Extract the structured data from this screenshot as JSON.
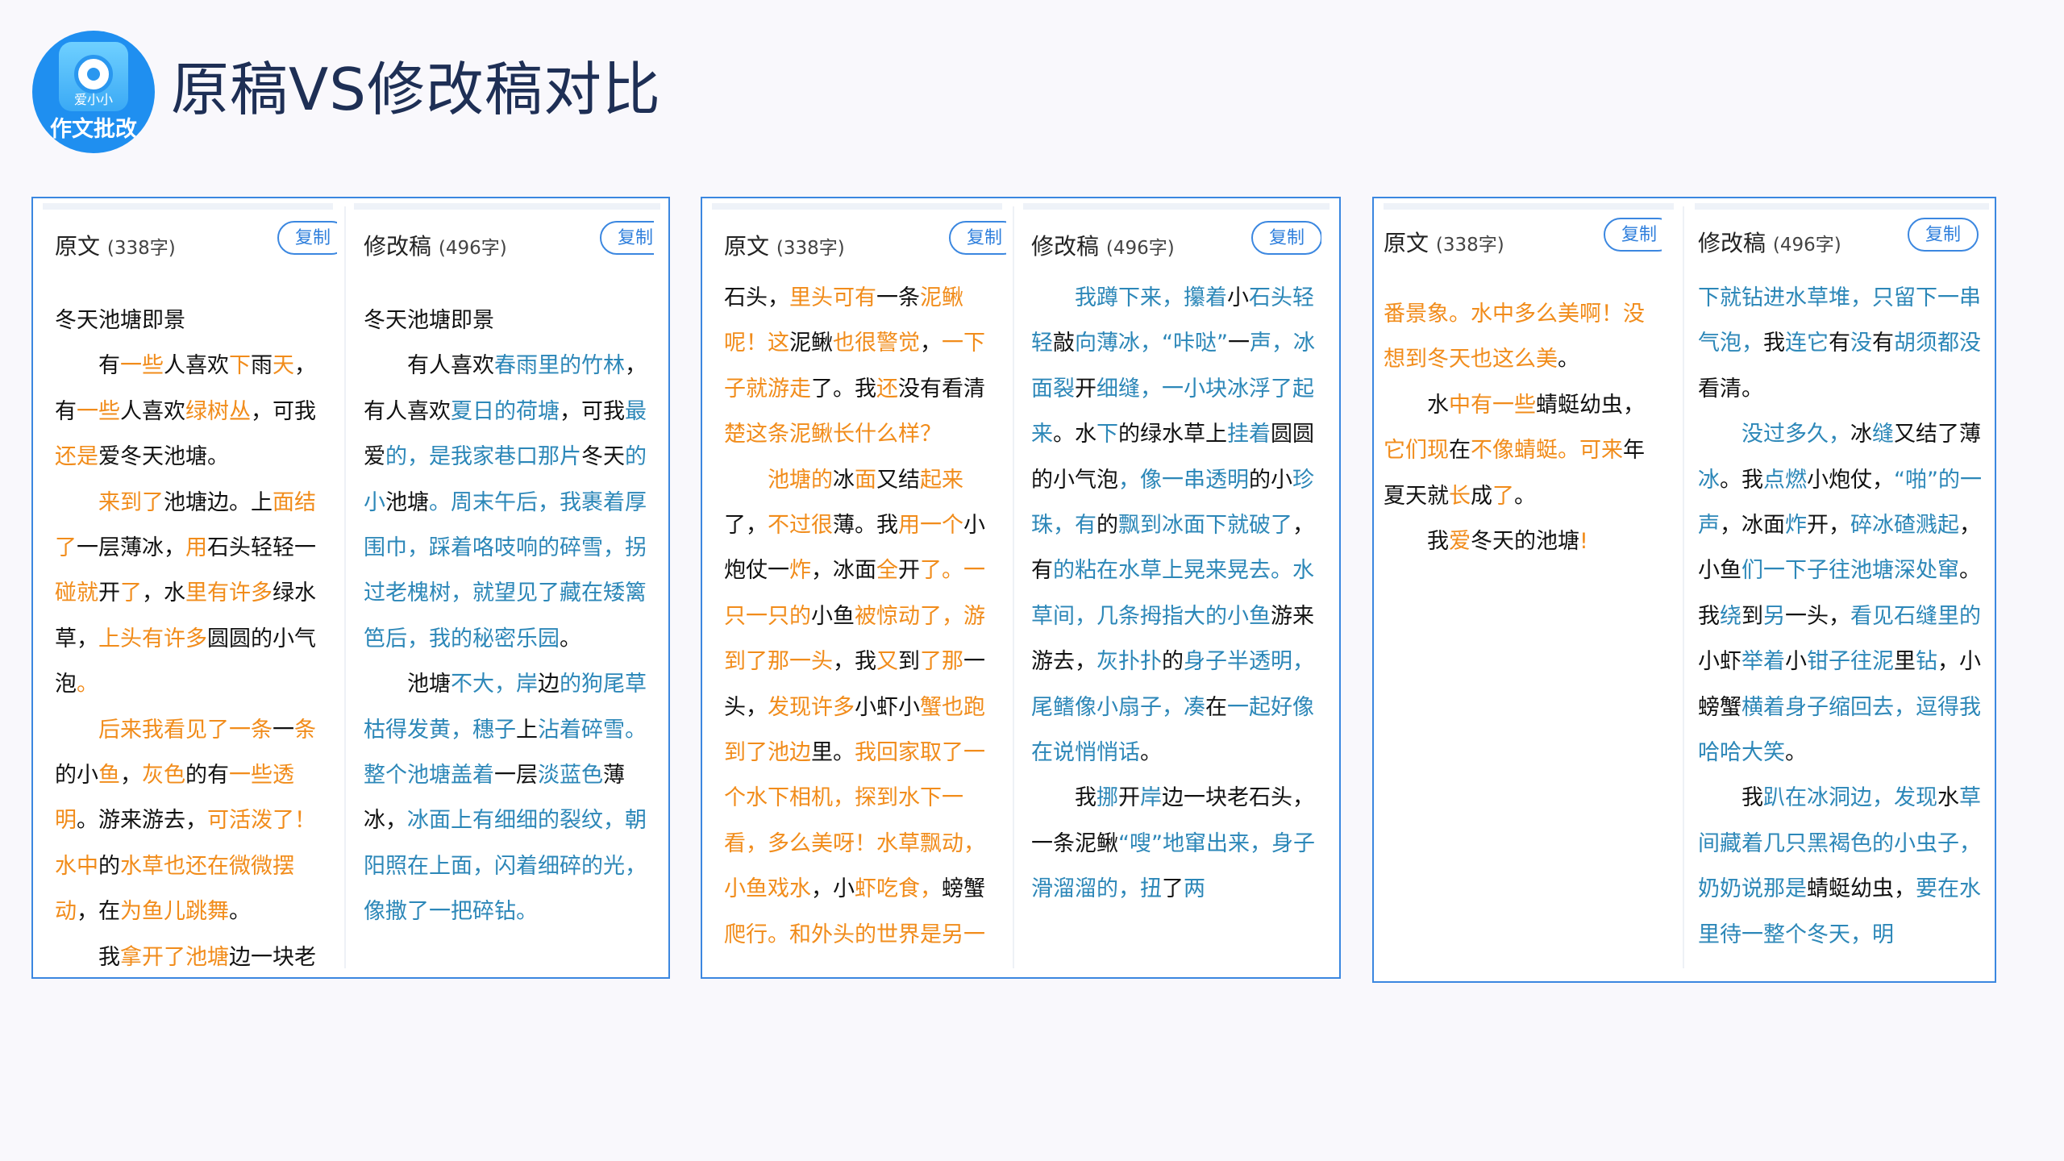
{
  "header": {
    "logo_sub": "爱小小",
    "logo_name": "作文批改",
    "title": "原稿VS修改稿对比"
  },
  "labels": {
    "original": "原文",
    "original_count": "(338字)",
    "revised": "修改稿",
    "revised_count": "(496字)",
    "copy": "复制"
  },
  "panels": [
    {
      "left": [
        [
          [
            "k",
            "冬天池塘即景"
          ]
        ],
        [
          [
            "k",
            "有"
          ],
          [
            "o",
            "一些"
          ],
          [
            "k",
            "人喜欢"
          ],
          [
            "o",
            "下"
          ],
          [
            "k",
            "雨"
          ],
          [
            "o",
            "天"
          ],
          [
            "k",
            "，有"
          ],
          [
            "o",
            "一些"
          ],
          [
            "k",
            "人喜欢"
          ],
          [
            "o",
            "绿树丛"
          ],
          [
            "k",
            "，可我"
          ],
          [
            "o",
            "还是"
          ],
          [
            "k",
            "爱冬天池塘。"
          ]
        ],
        [
          [
            "o",
            "来到了"
          ],
          [
            "k",
            "池塘边。上"
          ],
          [
            "o",
            "面结了"
          ],
          [
            "k",
            "一层薄冰，"
          ],
          [
            "o",
            "用"
          ],
          [
            "k",
            "石头轻轻一"
          ],
          [
            "o",
            "碰就"
          ],
          [
            "k",
            "开"
          ],
          [
            "o",
            "了"
          ],
          [
            "k",
            "，水"
          ],
          [
            "o",
            "里有许多"
          ],
          [
            "k",
            "绿水草，"
          ],
          [
            "o",
            "上头有许多"
          ],
          [
            "k",
            "圆圆的小气泡"
          ],
          [
            "o",
            "。"
          ]
        ],
        [
          [
            "o",
            "后来我看见了一条"
          ],
          [
            "k",
            "一"
          ],
          [
            "o",
            "条"
          ],
          [
            "k",
            "的小"
          ],
          [
            "o",
            "鱼"
          ],
          [
            "k",
            "，"
          ],
          [
            "o",
            "灰色"
          ],
          [
            "k",
            "的有"
          ],
          [
            "o",
            "一些透明"
          ],
          [
            "k",
            "。游来游去，"
          ],
          [
            "o",
            "可活泼了！水中"
          ],
          [
            "k",
            "的"
          ],
          [
            "o",
            "水草也还在微微摆动"
          ],
          [
            "k",
            "，在"
          ],
          [
            "o",
            "为鱼儿跳舞"
          ],
          [
            "k",
            "。"
          ]
        ],
        [
          [
            "k",
            "我"
          ],
          [
            "o",
            "拿开了池塘"
          ],
          [
            "k",
            "边一块老"
          ]
        ]
      ],
      "right": [
        [
          [
            "k",
            "冬天池塘即景"
          ]
        ],
        [
          [
            "k",
            "有人喜欢"
          ],
          [
            "b",
            "春雨里的竹林"
          ],
          [
            "k",
            "，有人喜欢"
          ],
          [
            "b",
            "夏日的荷塘"
          ],
          [
            "k",
            "，可我"
          ],
          [
            "b",
            "最"
          ],
          [
            "k",
            "爱"
          ],
          [
            "b",
            "的，是我家巷口那片"
          ],
          [
            "k",
            "冬天"
          ],
          [
            "b",
            "的小"
          ],
          [
            "k",
            "池塘"
          ],
          [
            "b",
            "。周末午后，我裹着厚围巾，踩着咯吱响的碎雪，拐过老槐树，就望见了藏在矮篱笆后，我的秘密乐园"
          ],
          [
            "k",
            "。"
          ]
        ],
        [
          [
            "k",
            "池塘"
          ],
          [
            "b",
            "不大，岸"
          ],
          [
            "k",
            "边"
          ],
          [
            "b",
            "的狗尾草枯得发黄，穗子"
          ],
          [
            "k",
            "上"
          ],
          [
            "b",
            "沾着碎雪。整个池塘盖着"
          ],
          [
            "k",
            "一层"
          ],
          [
            "b",
            "淡蓝色"
          ],
          [
            "k",
            "薄冰，"
          ],
          [
            "b",
            "冰面上有细细的裂纹，朝阳照在上面，闪着细碎的光，像撒了一把碎钻。"
          ]
        ]
      ]
    },
    {
      "left": [
        [
          [
            "k",
            "石头，"
          ],
          [
            "o",
            "里头可有"
          ],
          [
            "k",
            "一条"
          ],
          [
            "o",
            "泥鳅呢！这"
          ],
          [
            "k",
            "泥鳅"
          ],
          [
            "o",
            "也很警觉"
          ],
          [
            "k",
            "，"
          ],
          [
            "o",
            "一下子就游走"
          ],
          [
            "k",
            "了。我"
          ],
          [
            "o",
            "还"
          ],
          [
            "k",
            "没有看清"
          ],
          [
            "o",
            "楚这条泥鳅长什么样？"
          ]
        ],
        [
          [
            "o",
            "池塘的"
          ],
          [
            "k",
            "冰"
          ],
          [
            "o",
            "面"
          ],
          [
            "k",
            "又结"
          ],
          [
            "o",
            "起来"
          ],
          [
            "k",
            "了，"
          ],
          [
            "o",
            "不过很"
          ],
          [
            "k",
            "薄。我"
          ],
          [
            "o",
            "用一个"
          ],
          [
            "k",
            "小炮仗一"
          ],
          [
            "o",
            "炸"
          ],
          [
            "k",
            "，冰面"
          ],
          [
            "o",
            "全"
          ],
          [
            "k",
            "开"
          ],
          [
            "o",
            "了。一只一只的"
          ],
          [
            "k",
            "小鱼"
          ],
          [
            "o",
            "被惊动了，游到了那一头"
          ],
          [
            "k",
            "，我"
          ],
          [
            "o",
            "又"
          ],
          [
            "k",
            "到"
          ],
          [
            "o",
            "了那"
          ],
          [
            "k",
            "一头，"
          ],
          [
            "o",
            "发现许多"
          ],
          [
            "k",
            "小虾小"
          ],
          [
            "o",
            "蟹也跑到了池边"
          ],
          [
            "k",
            "里。"
          ],
          [
            "o",
            "我回家取了一个水下相机，探到水下一看，多么美呀！水草飘动，小鱼戏水"
          ],
          [
            "k",
            "，小"
          ],
          [
            "o",
            "虾吃食，"
          ],
          [
            "k",
            "螃蟹"
          ],
          [
            "o",
            "爬行。和外头的世界是另一"
          ]
        ]
      ],
      "right": [
        [
          [
            "b",
            "我蹲下来，攥着"
          ],
          [
            "k",
            "小"
          ],
          [
            "b",
            "石头轻轻"
          ],
          [
            "k",
            "敲"
          ],
          [
            "b",
            "向薄冰，“咔哒”"
          ],
          [
            "k",
            "一"
          ],
          [
            "b",
            "声，冰面裂"
          ],
          [
            "k",
            "开"
          ],
          [
            "b",
            "细缝，一小块冰浮了起来"
          ],
          [
            "k",
            "。水"
          ],
          [
            "b",
            "下"
          ],
          [
            "k",
            "的绿水草上"
          ],
          [
            "b",
            "挂着"
          ],
          [
            "k",
            "圆圆的小气泡"
          ],
          [
            "b",
            "，像一串透明"
          ],
          [
            "k",
            "的小"
          ],
          [
            "b",
            "珍珠，有"
          ],
          [
            "k",
            "的"
          ],
          [
            "b",
            "飘到冰面下就破了"
          ],
          [
            "k",
            "，有"
          ],
          [
            "b",
            "的粘在水草上晃来晃去。水草间，几条拇指大的小鱼"
          ],
          [
            "k",
            "游来游去，"
          ],
          [
            "b",
            "灰扑扑"
          ],
          [
            "k",
            "的"
          ],
          [
            "b",
            "身子半透明，尾鳍像小扇子，凑"
          ],
          [
            "k",
            "在"
          ],
          [
            "b",
            "一起好像在说悄悄话"
          ],
          [
            "k",
            "。"
          ]
        ],
        [
          [
            "k",
            "我"
          ],
          [
            "b",
            "挪"
          ],
          [
            "k",
            "开"
          ],
          [
            "b",
            "岸"
          ],
          [
            "k",
            "边一块老石头，一条泥鳅"
          ],
          [
            "b",
            "“嗖”地窜出来，身子滑溜溜的，扭"
          ],
          [
            "k",
            "了"
          ],
          [
            "b",
            "两"
          ]
        ]
      ]
    },
    {
      "left": [
        [
          [
            "o",
            "番景象。水中多么美啊！没想到冬天也这么美"
          ],
          [
            "k",
            "。"
          ]
        ],
        [
          [
            "k",
            "水"
          ],
          [
            "o",
            "中有一些"
          ],
          [
            "k",
            "蜻蜓幼虫，"
          ],
          [
            "o",
            "它们现"
          ],
          [
            "k",
            "在"
          ],
          [
            "o",
            "不像蜻蜓。可来"
          ],
          [
            "k",
            "年夏天就"
          ],
          [
            "o",
            "长"
          ],
          [
            "k",
            "成"
          ],
          [
            "o",
            "了"
          ],
          [
            "k",
            "。"
          ]
        ],
        [
          [
            "k",
            "我"
          ],
          [
            "o",
            "爱"
          ],
          [
            "k",
            "冬天的池塘"
          ],
          [
            "o",
            "!"
          ]
        ]
      ],
      "right": [
        [
          [
            "b",
            "下就钻进水草堆，只留下一串气泡，"
          ],
          [
            "k",
            "我"
          ],
          [
            "b",
            "连它"
          ],
          [
            "k",
            "有"
          ],
          [
            "b",
            "没"
          ],
          [
            "k",
            "有"
          ],
          [
            "b",
            "胡须都没"
          ],
          [
            "k",
            "看清。"
          ]
        ],
        [
          [
            "b",
            "没过多久，"
          ],
          [
            "k",
            "冰"
          ],
          [
            "b",
            "缝"
          ],
          [
            "k",
            "又结了薄"
          ],
          [
            "b",
            "冰"
          ],
          [
            "k",
            "。我"
          ],
          [
            "b",
            "点燃"
          ],
          [
            "k",
            "小炮仗，"
          ],
          [
            "b",
            "“啪”的一声"
          ],
          [
            "k",
            "，冰面"
          ],
          [
            "b",
            "炸"
          ],
          [
            "k",
            "开，"
          ],
          [
            "b",
            "碎冰碴溅起"
          ],
          [
            "k",
            "，小鱼"
          ],
          [
            "b",
            "们一下子往池塘深处窜"
          ],
          [
            "k",
            "。我"
          ],
          [
            "b",
            "绕"
          ],
          [
            "k",
            "到"
          ],
          [
            "b",
            "另"
          ],
          [
            "k",
            "一头，"
          ],
          [
            "b",
            "看见石缝里的"
          ],
          [
            "k",
            "小虾"
          ],
          [
            "b",
            "举着"
          ],
          [
            "k",
            "小"
          ],
          [
            "b",
            "钳子往泥"
          ],
          [
            "k",
            "里"
          ],
          [
            "b",
            "钻"
          ],
          [
            "k",
            "，小螃蟹"
          ],
          [
            "b",
            "横着身子缩回去，逗得我哈哈大笑"
          ],
          [
            "k",
            "。"
          ]
        ],
        [
          [
            "k",
            "我"
          ],
          [
            "b",
            "趴在冰洞边，发现"
          ],
          [
            "k",
            "水"
          ],
          [
            "b",
            "草间藏着几只黑褐色的小虫子，奶奶说那是"
          ],
          [
            "k",
            "蜻蜓幼虫，"
          ],
          [
            "b",
            "要在水里待一整个冬天，明"
          ]
        ]
      ]
    }
  ]
}
